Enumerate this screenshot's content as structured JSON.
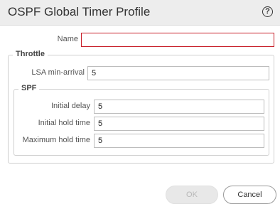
{
  "dialog": {
    "title": "OSPF Global Timer Profile",
    "help_icon": "?"
  },
  "form": {
    "name": {
      "label": "Name",
      "value": "",
      "state": "error"
    },
    "throttle": {
      "legend": "Throttle",
      "lsa_min_arrival": {
        "label": "LSA min-arrival",
        "value": "5"
      },
      "spf": {
        "legend": "SPF",
        "initial_delay": {
          "label": "Initial delay",
          "value": "5"
        },
        "initial_hold_time": {
          "label": "Initial hold time",
          "value": "5"
        },
        "maximum_hold_time": {
          "label": "Maximum hold time",
          "value": "5"
        }
      }
    }
  },
  "buttons": {
    "ok": {
      "label": "OK",
      "disabled": true
    },
    "cancel": {
      "label": "Cancel"
    }
  },
  "colors": {
    "title_bar": "#ededed",
    "error_border": "#c8202a"
  }
}
